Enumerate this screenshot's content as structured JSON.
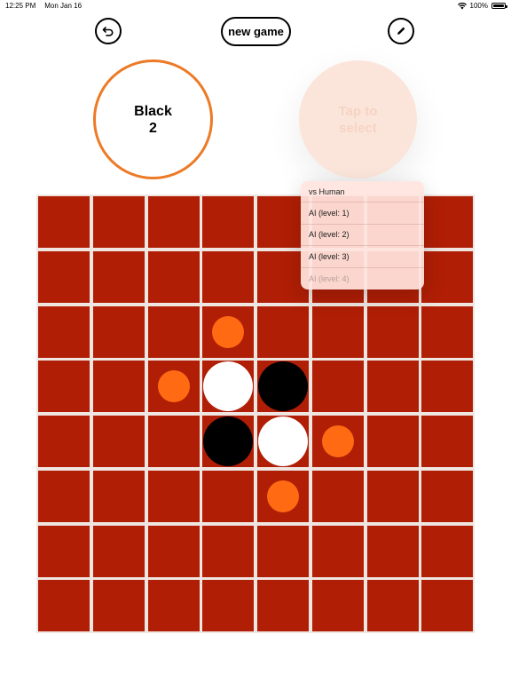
{
  "statusbar": {
    "time": "12:25 PM",
    "date": "Mon Jan 16",
    "battery": "100%"
  },
  "toolbar": {
    "undo_icon": "undo-icon",
    "new_game_label": "new game",
    "edit_icon": "pencil-icon"
  },
  "player": {
    "name": "Black",
    "score": "2"
  },
  "opponent": {
    "prompt": "Tap to select"
  },
  "menu": {
    "items": [
      {
        "label": "vs Human"
      },
      {
        "label": "AI (level: 1)"
      },
      {
        "label": "AI (level: 2)"
      },
      {
        "label": "AI (level: 3)"
      },
      {
        "label": "AI (level: 4)"
      }
    ]
  },
  "board": {
    "size": 8,
    "pieces": [
      {
        "row": 3,
        "col": 3,
        "color": "white"
      },
      {
        "row": 3,
        "col": 4,
        "color": "black"
      },
      {
        "row": 4,
        "col": 3,
        "color": "black"
      },
      {
        "row": 4,
        "col": 4,
        "color": "white"
      }
    ],
    "valid_moves": [
      {
        "row": 2,
        "col": 3
      },
      {
        "row": 3,
        "col": 2
      },
      {
        "row": 4,
        "col": 5
      },
      {
        "row": 5,
        "col": 4
      }
    ]
  },
  "colors": {
    "board_cell": "#b01e05",
    "accent": "#ec7a26",
    "hint": "#ff6a13"
  }
}
